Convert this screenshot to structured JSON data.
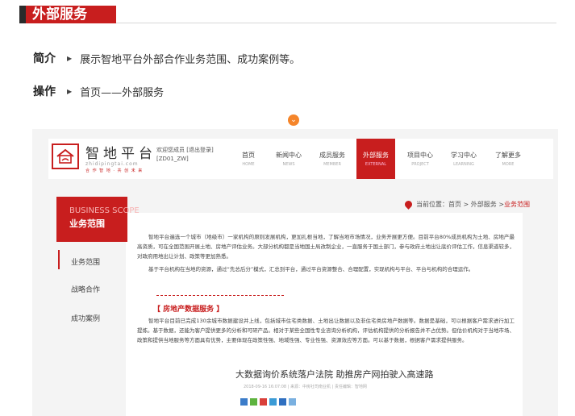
{
  "header": {
    "title": "外部服务"
  },
  "intro": {
    "label": "简介",
    "text": "展示智地平台外部合作业务范围、成功案例等。"
  },
  "operation": {
    "label": "操作",
    "text": "首页——外部服务"
  },
  "screenshot": {
    "logo": {
      "name": "智地平台",
      "pinyin": "zhidipingtai.com",
      "slogan": "合 作 智 地 · 共 创 未 来"
    },
    "user": {
      "welcome": "欢迎您成员 [退出登录]",
      "id": "[ZD01_ZW]"
    },
    "nav": [
      {
        "cn": "首页",
        "en": "HOME"
      },
      {
        "cn": "新闻中心",
        "en": "NEWS"
      },
      {
        "cn": "成员服务",
        "en": "MEMBER"
      },
      {
        "cn": "外部服务",
        "en": "EXTERNAL",
        "active": true
      },
      {
        "cn": "项目中心",
        "en": "PROJECT"
      },
      {
        "cn": "学习中心",
        "en": "LEARNING"
      },
      {
        "cn": "了解更多",
        "en": "MORE"
      }
    ],
    "sidebar": {
      "banner_en": "BUSINESS SCOPE",
      "banner_cn": "业务范围",
      "items": [
        "业务范围",
        "战略合作",
        "成功案例"
      ]
    },
    "breadcrumb": {
      "prefix": "当前位置：首页 > 外部服务 > ",
      "current": "业务范围"
    },
    "content": {
      "p1": "智地平台遍选一个城市（地级市）一家机构的原则发展机构，更加扎根当地，了解当地市场情况，业务开展更方便。目前平台80%成员机构为土地、房地产最高资质，可在全国范围开展土地、房地产评估业务。大部分机构都是当地国土局改制企业，一直服务于国土部门，参与政府土地出让底价评估工作，信息渠道较多，对政府用地出让计划、政策等更加熟悉。",
      "p2": "基于平台机构在当地的资源，通过“先总后分”模式，汇总到平台，通过平台资源整合、合理配置，实现机构与平台、平台与机构的合理运作。",
      "section_title": "【 房地产数据服务 】",
      "p3": "智地平台目前已完成130余城市数据建设并上线，包括城市住宅类数据、土地出让数据以及非住宅类房地产数据等。数据是基础，可以根据客户需求进行加工提炼。基于数据，还能为客户提供更多的分析和可研产品。相对于某些全国性专业咨询分析机构，评估机构提供的分析报告并不占优势。但估价机构对于当地市场、政策和提供当地服务等方面具有优势，主要体现在政策性强、地域性强、专业性强、资源效应等方面。可以基于数据，根据客户需求提供服务。",
      "news_title": "大数据询价系统落户法院 助推房产网拍驶入高速路",
      "news_meta": "2018-09-16 16:07:08  |  来源：中房社司南业机  |  责任编辑：智地网"
    }
  },
  "colors": {
    "accent": "#c81e1e",
    "orange": "#f5852a"
  }
}
